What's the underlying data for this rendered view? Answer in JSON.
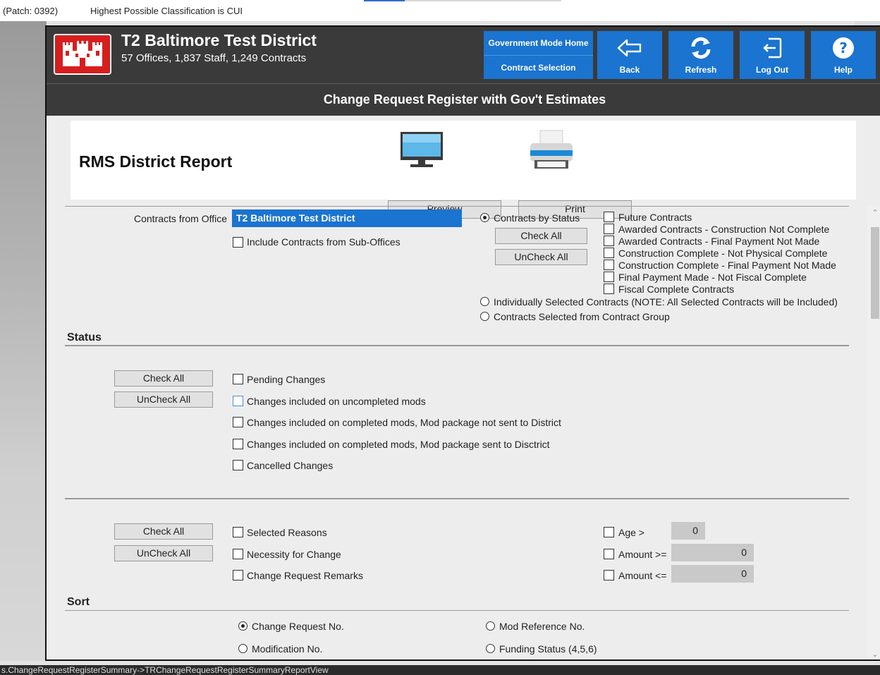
{
  "topbar": {
    "patch": "(Patch: 0392)",
    "classification": "Highest Possible Classification is CUI"
  },
  "header": {
    "district_name": "T2 Baltimore Test District",
    "district_stats": "57 Offices, 1,837 Staff, 1,249 Contracts",
    "gov_mode_home": "Government Mode Home",
    "contract_selection": "Contract Selection",
    "back": "Back",
    "refresh": "Refresh",
    "log_out": "Log Out",
    "help": "Help"
  },
  "page_title": "Change Request Register with Gov't Estimates",
  "report": {
    "title": "RMS District Report",
    "preview_label": "Preview",
    "print_label": "Print"
  },
  "contracts": {
    "from_office_label": "Contracts from Office",
    "office_value": "T2 Baltimore Test District",
    "include_sub_offices": "Include Contracts from Sub-Offices",
    "by_status_label": "Contracts by Status",
    "check_all": "Check All",
    "uncheck_all": "UnCheck All",
    "status_options": [
      "Future Contracts",
      "Awarded Contracts - Construction Not Complete",
      "Awarded Contracts - Final Payment Not Made",
      "Construction Complete - Not Physical Complete",
      "Construction Complete - Final Payment Not Made",
      "Final Payment Made - Not Fiscal Complete",
      "Fiscal Complete Contracts"
    ],
    "individually_selected": "Individually Selected Contracts (NOTE: All Selected Contracts will be Included)",
    "from_group": "Contracts Selected from Contract Group"
  },
  "status": {
    "heading": "Status",
    "check_all": "Check All",
    "uncheck_all": "UnCheck All",
    "options": [
      "Pending Changes",
      "Changes included on uncompleted mods",
      "Changes included on completed mods, Mod package not sent to District",
      "Changes included on completed mods, Mod package sent to Disctrict",
      "Cancelled Changes"
    ]
  },
  "fields": {
    "check_all": "Check All",
    "uncheck_all": "UnCheck All",
    "options": [
      "Selected Reasons",
      "Necessity for Change",
      "Change Request Remarks"
    ],
    "age_label": "Age >",
    "age_value": "0",
    "amount_ge_label": "Amount >=",
    "amount_ge_value": "0",
    "amount_le_label": "Amount <=",
    "amount_le_value": "0"
  },
  "sort": {
    "heading": "Sort",
    "change_request_no": "Change Request No.",
    "modification_no": "Modification No.",
    "mod_reference_no": "Mod Reference No.",
    "funding_status": "Funding Status (4,5,6)"
  },
  "statusbar": "s.ChangeRequestRegisterSummary->TRChangeRequestRegisterSummaryReportView",
  "colors": {
    "accent_blue": "#1a74d0",
    "header_dark": "#3a3a3a",
    "logo_red": "#d71e1e"
  }
}
